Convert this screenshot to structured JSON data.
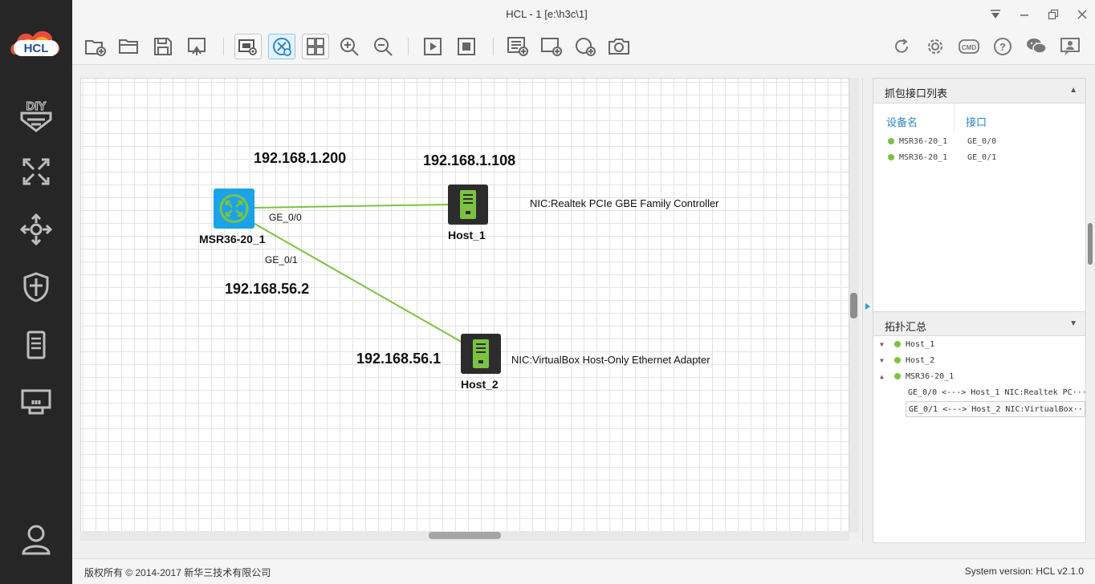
{
  "window": {
    "title": "HCL - 1 [e:\\h3c\\1]"
  },
  "logo": {
    "text": "HCL"
  },
  "topology": {
    "devices": [
      {
        "name": "MSR36-20_1",
        "type": "router"
      },
      {
        "name": "Host_1",
        "type": "host"
      },
      {
        "name": "Host_2",
        "type": "host"
      }
    ],
    "ip_labels": [
      "192.168.1.200",
      "192.168.1.108",
      "192.168.56.2",
      "192.168.56.1"
    ],
    "interface_labels": [
      "GE_0/0",
      "GE_0/1"
    ],
    "nic_labels": [
      "NIC:Realtek PCIe GBE Family Controller",
      "NIC:VirtualBox Host-Only Ethernet Adapter"
    ],
    "link_color": "#7cc242"
  },
  "capture_panel": {
    "title": "抓包接口列表",
    "columns": [
      "设备名",
      "接口"
    ],
    "rows": [
      {
        "device": "MSR36-20_1",
        "port": "GE_0/0"
      },
      {
        "device": "MSR36-20_1",
        "port": "GE_0/1"
      }
    ]
  },
  "summary_panel": {
    "title": "拓扑汇总",
    "nodes": [
      "Host_1",
      "Host_2",
      "MSR36-20_1"
    ],
    "links": [
      "GE_0/0 <---> Host_1 NIC:Realtek PC···",
      "GE_0/1 <---> Host_2 NIC:VirtualBox···"
    ]
  },
  "footer": {
    "copyright": "版权所有 © 2014-2017 新华三技术有限公司",
    "version": "System version: HCL v2.1.0"
  },
  "colors": {
    "sidebar": "#262626",
    "accent": "#2f86c9",
    "router": "#1aa3e8",
    "host": "#7cc242"
  }
}
